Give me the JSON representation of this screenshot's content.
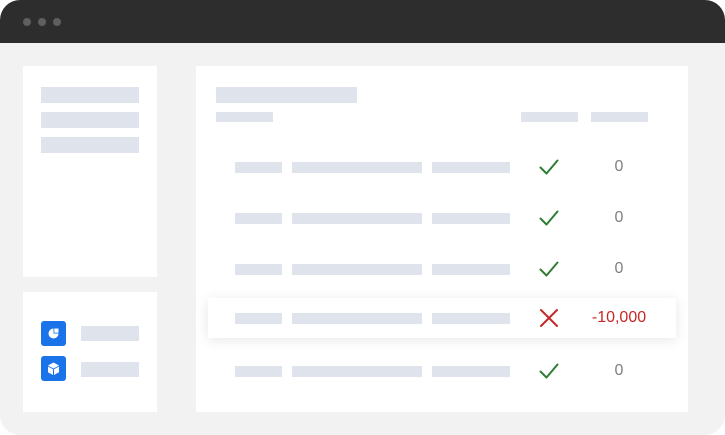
{
  "rows": [
    {
      "status": "success",
      "status_icon": "check-icon",
      "amount": "0"
    },
    {
      "status": "success",
      "status_icon": "check-icon",
      "amount": "0"
    },
    {
      "status": "success",
      "status_icon": "check-icon",
      "amount": "0"
    },
    {
      "status": "error",
      "status_icon": "cross-icon",
      "amount": "-10,000"
    },
    {
      "status": "success",
      "status_icon": "check-icon",
      "amount": "0"
    }
  ],
  "sidebar_apps": [
    {
      "icon": "app-icon"
    },
    {
      "icon": "cube-icon"
    }
  ],
  "colors": {
    "titlebar": "#2d2d2d",
    "window_bg": "#f2f2f2",
    "placeholder": "#dfe3ec",
    "success": "#2e7d32",
    "error": "#c62828",
    "amount_text": "#7f7f7f",
    "app_tile": "#1a73e8"
  }
}
